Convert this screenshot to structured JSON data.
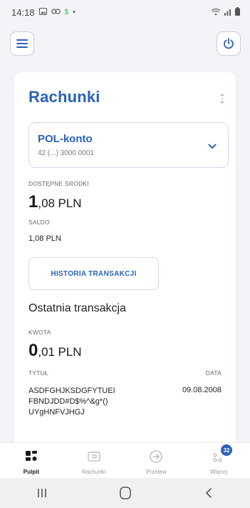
{
  "status_bar": {
    "time": "14:18",
    "icons": [
      "image-icon",
      "link-icon",
      "dollar-icon",
      "dot-icon"
    ],
    "right_icons": [
      "wifi-icon",
      "signal-icon",
      "battery-icon"
    ]
  },
  "header": {
    "menu_icon": "menu-icon",
    "power_icon": "power-icon"
  },
  "card": {
    "title": "Rachunki",
    "account": {
      "name": "POL-konto",
      "number": "42 (...) 3000 0001"
    },
    "available_label": "DOSTĘPNE ŚRODKI",
    "available_int": "1",
    "available_dec": ",08",
    "available_cur": "PLN",
    "saldo_label": "SALDO",
    "saldo_value": "1,08 PLN",
    "history_button": "HISTORIA TRANSAKCJI",
    "last_tx_title": "Ostatnia transakcja",
    "kwota_label": "KWOTA",
    "kwota_int": "0",
    "kwota_dec": ",01",
    "kwota_cur": "PLN",
    "tytul_label": "TYTUŁ",
    "tytul_lines": [
      "ASDFGHJKSDGFYTUEI",
      "FBNDJDD#D$%^&g*()",
      "UYgHNFVJHGJ"
    ],
    "data_label": "DATA",
    "data_value": "09.08.2008"
  },
  "bottom_nav": {
    "items": [
      {
        "label": "Pulpit",
        "icon": "dashboard-icon",
        "active": true
      },
      {
        "label": "Rachunki",
        "icon": "wallet-icon",
        "active": false
      },
      {
        "label": "Przelew",
        "icon": "transfer-icon",
        "active": false
      },
      {
        "label": "Więcej",
        "icon": "more-icon",
        "active": false,
        "badge": "32"
      }
    ]
  },
  "system_nav": [
    "recents-icon",
    "home-icon",
    "back-icon"
  ],
  "colors": {
    "accent": "#2a62b6",
    "background": "#f3f4f8",
    "card": "#ffffff",
    "border": "#d5d8ec"
  }
}
